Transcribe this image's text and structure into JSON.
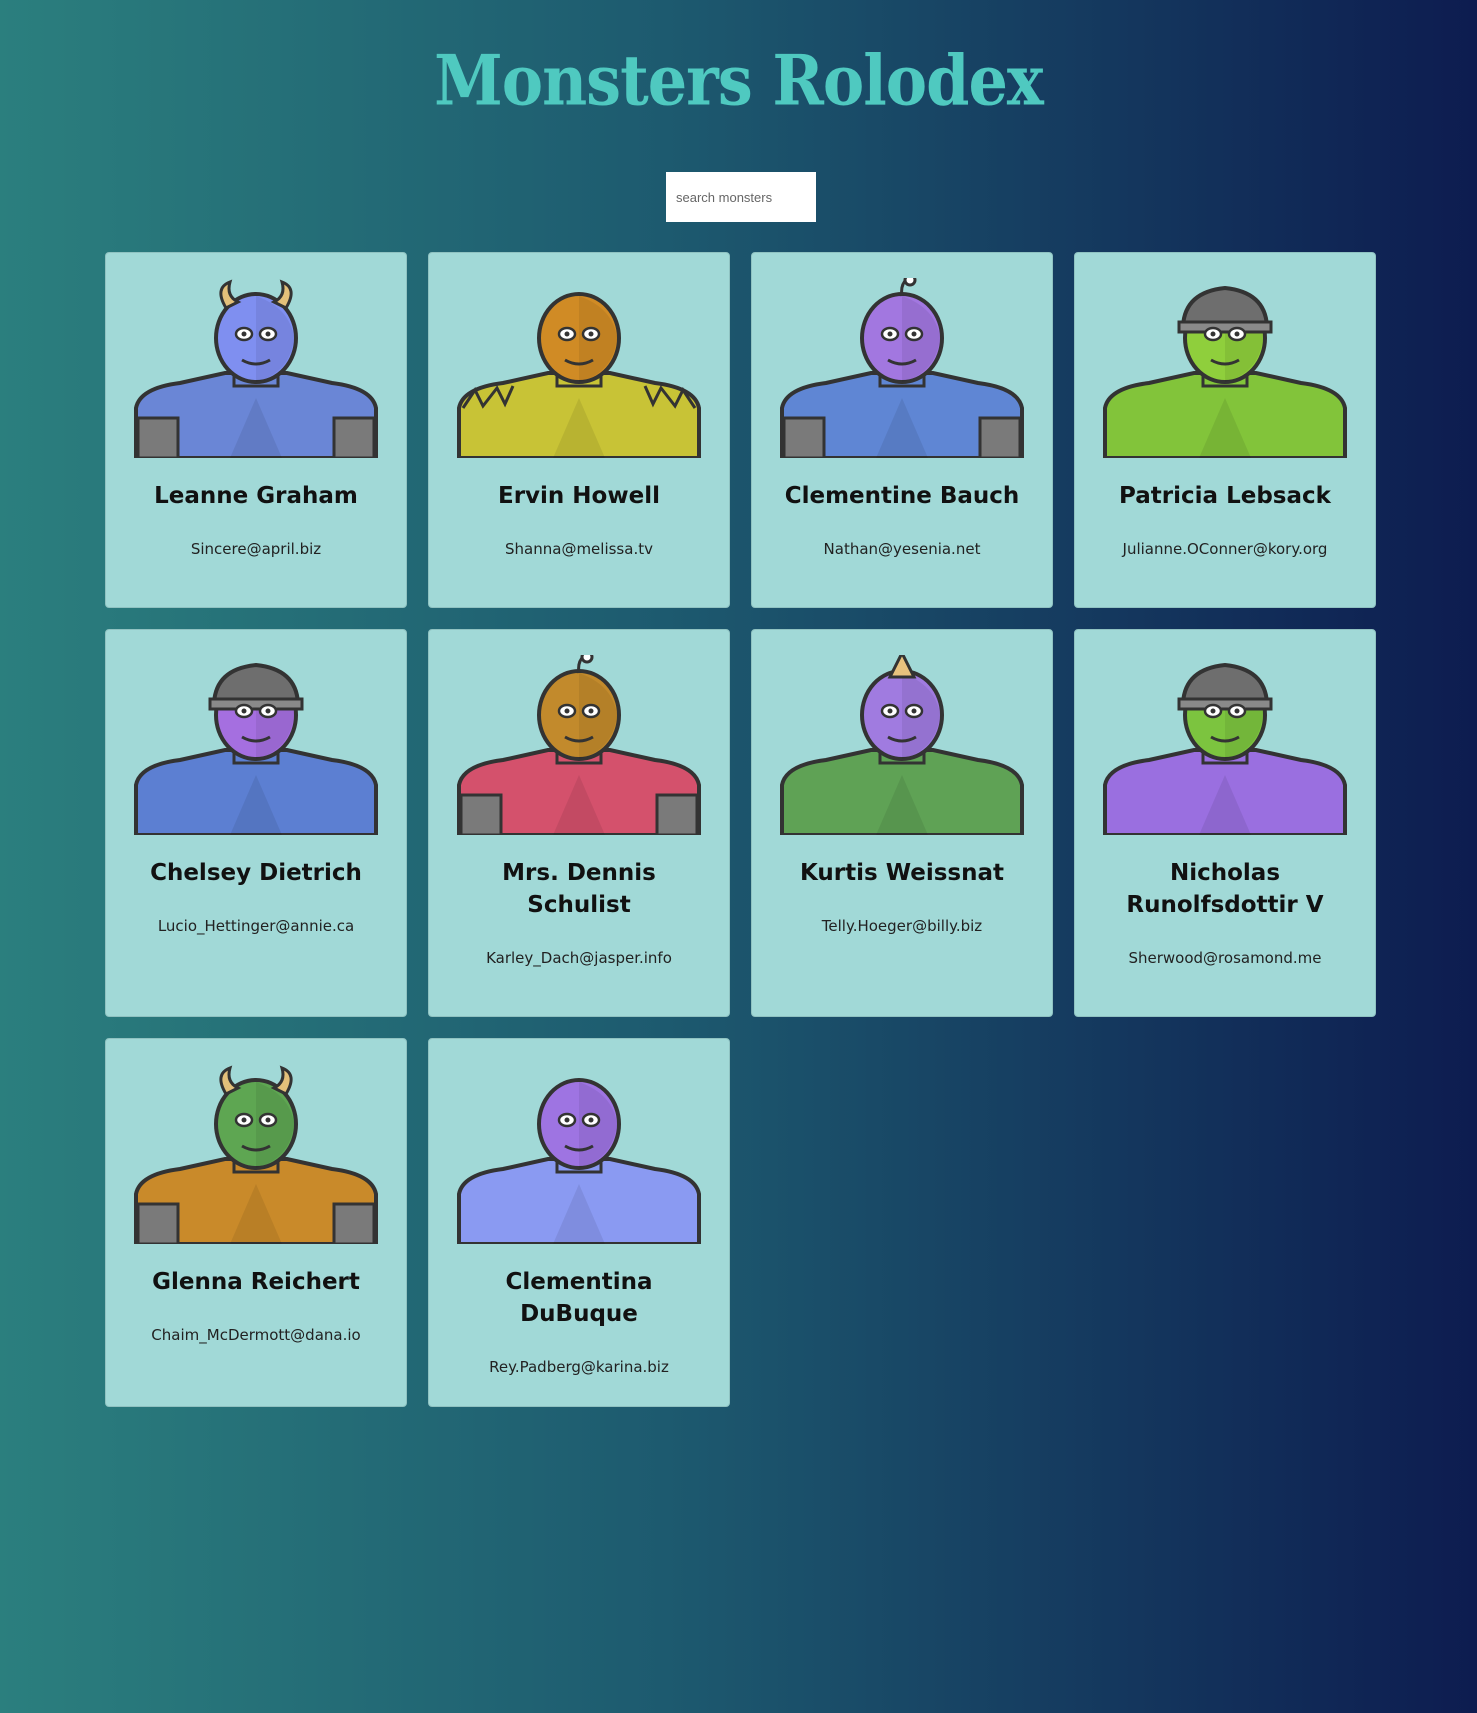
{
  "app": {
    "title": "Monsters Rolodex"
  },
  "search": {
    "placeholder": "search monsters",
    "value": ""
  },
  "monsters": [
    {
      "name": "Leanne Graham",
      "email": "Sincere@april.biz",
      "skin": "#7f8ff0",
      "body": "#6a86d6",
      "feature": "horns",
      "icon": "monster-icon"
    },
    {
      "name": "Ervin Howell",
      "email": "Shanna@melissa.tv",
      "skin": "#d08b25",
      "body": "#c8c336",
      "feature": "spikes",
      "icon": "monster-icon"
    },
    {
      "name": "Clementine Bauch",
      "email": "Nathan@yesenia.net",
      "skin": "#a277e0",
      "body": "#5f86d4",
      "feature": "antenna",
      "icon": "monster-icon"
    },
    {
      "name": "Patricia Lebsack",
      "email": "Julianne.OConner@kory.org",
      "skin": "#8fcf3c",
      "body": "#82c43a",
      "feature": "helmet",
      "icon": "monster-icon"
    },
    {
      "name": "Chelsey Dietrich",
      "email": "Lucio_Hettinger@annie.ca",
      "skin": "#a56fe0",
      "body": "#5c7fd2",
      "feature": "helmet",
      "icon": "monster-icon"
    },
    {
      "name": "Mrs. Dennis Schulist",
      "email": "Karley_Dach@jasper.info",
      "skin": "#c28a2c",
      "body": "#d4516c",
      "feature": "antenna",
      "icon": "monster-icon"
    },
    {
      "name": "Kurtis Weissnat",
      "email": "Telly.Hoeger@billy.biz",
      "skin": "#a07be0",
      "body": "#5fa255",
      "feature": "horn",
      "icon": "monster-icon"
    },
    {
      "name": "Nicholas Runolfsdottir V",
      "email": "Sherwood@rosamond.me",
      "skin": "#7cc43f",
      "body": "#9a6fe0",
      "feature": "helmet",
      "icon": "monster-icon"
    },
    {
      "name": "Glenna Reichert",
      "email": "Chaim_McDermott@dana.io",
      "skin": "#5ea652",
      "body": "#c98a2a",
      "feature": "horns",
      "icon": "monster-icon"
    },
    {
      "name": "Clementina DuBuque",
      "email": "Rey.Padberg@karina.biz",
      "skin": "#9e74e2",
      "body": "#8a9af2",
      "feature": "none",
      "icon": "monster-icon"
    }
  ]
}
